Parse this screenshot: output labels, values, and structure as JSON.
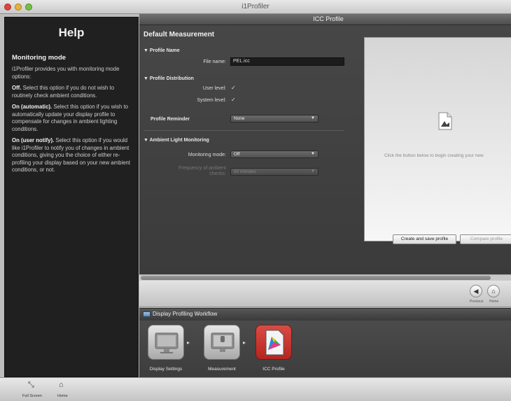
{
  "window": {
    "title": "i1Profiler"
  },
  "help": {
    "title": "Help",
    "section": "Monitoring mode",
    "intro": "i1Profiler provides you with monitoring mode options:",
    "opt1_bold": "Off.",
    "opt1_text": " Select this option if you do not wish to routinely check ambient conditions.",
    "opt2_bold": "On (automatic).",
    "opt2_text": " Select this option if you wish to automatically update your display profile to compensate for changes in ambient lighting conditions.",
    "opt3_bold": "On (user notify).",
    "opt3_text": " Select this option if you would like i1Profiler to notify you of changes in ambient conditions, giving you the choice of either re-profiling your display based on your new ambient conditions, or not."
  },
  "main": {
    "header": "ICC Profile",
    "panel_title": "Default Measurement",
    "profile_name": {
      "group": "▼ Profile Name",
      "label": "File name:",
      "value": "PEL.icc"
    },
    "distribution": {
      "group": "▼ Profile Distribution",
      "user_label": "User level:",
      "user_check": "✓",
      "system_label": "System level:",
      "system_check": "✓"
    },
    "reminder": {
      "label": "Profile Reminder",
      "value": "None"
    },
    "ambient": {
      "group": "▼ Ambient Light Monitoring",
      "mode_label": "Monitoring mode:",
      "mode_value": "Off",
      "freq_label": "Frequency of ambient",
      "freq_label2": "checks:",
      "freq_value": "60 minutes"
    }
  },
  "preview": {
    "text": "Click the button below to begin creating your new",
    "create_button": "Create and save profile",
    "compare_button": "Compare profile"
  },
  "nav": {
    "previous": "Previous",
    "home": "Home"
  },
  "workflow": {
    "title": "Display Profiling Workflow",
    "steps": [
      "Display Settings",
      "Measurement",
      "ICC Profile"
    ]
  },
  "bottom": {
    "fullscreen": "Full Screen",
    "home": "Home"
  }
}
